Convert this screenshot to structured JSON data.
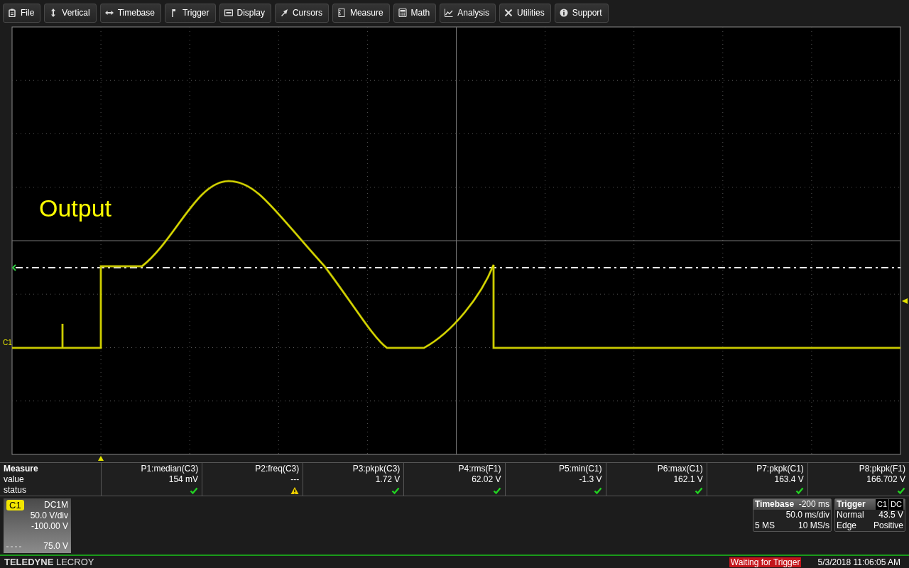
{
  "menu": [
    {
      "label": "File"
    },
    {
      "label": "Vertical"
    },
    {
      "label": "Timebase"
    },
    {
      "label": "Trigger"
    },
    {
      "label": "Display"
    },
    {
      "label": "Cursors"
    },
    {
      "label": "Measure"
    },
    {
      "label": "Math"
    },
    {
      "label": "Analysis"
    },
    {
      "label": "Utilities"
    },
    {
      "label": "Support"
    }
  ],
  "display": {
    "trace_label": "Output",
    "channel_marker": "C1"
  },
  "measure": {
    "title": "Measure",
    "row_labels": [
      "value",
      "status"
    ],
    "params": [
      {
        "name": "P1:median(C3)",
        "value": "154 mV",
        "warning": false
      },
      {
        "name": "P2:freq(C3)",
        "value": "---",
        "warning": true
      },
      {
        "name": "P3:pkpk(C3)",
        "value": "1.72 V",
        "warning": false
      },
      {
        "name": "P4:rms(F1)",
        "value": "62.02 V",
        "warning": false
      },
      {
        "name": "P5:min(C1)",
        "value": "-1.3 V",
        "warning": false
      },
      {
        "name": "P6:max(C1)",
        "value": "162.1 V",
        "warning": false
      },
      {
        "name": "P7:pkpk(C1)",
        "value": "163.4 V",
        "warning": false
      },
      {
        "name": "P8:pkpk(F1)",
        "value": "166.702 V",
        "warning": false
      }
    ]
  },
  "channel": {
    "badge": "C1",
    "coupling": "DC1M",
    "scale": "50.0 V/div",
    "offset": "-100.00 V",
    "level": "75.0 V"
  },
  "timebase": {
    "title": "Timebase",
    "delay": "-200 ms",
    "scale": "50.0 ms/div",
    "samples": "5 MS",
    "rate": "10 MS/s"
  },
  "trigger": {
    "title": "Trigger",
    "source": "C1",
    "coupling": "DC",
    "mode": "Normal",
    "level": "43.5 V",
    "type": "Edge",
    "slope": "Positive"
  },
  "status_bar": {
    "brand": "**TELEDYNE** LECROY",
    "status": "Waiting for Trigger",
    "datetime": "5/3/2018 11:06:05 AM"
  }
}
